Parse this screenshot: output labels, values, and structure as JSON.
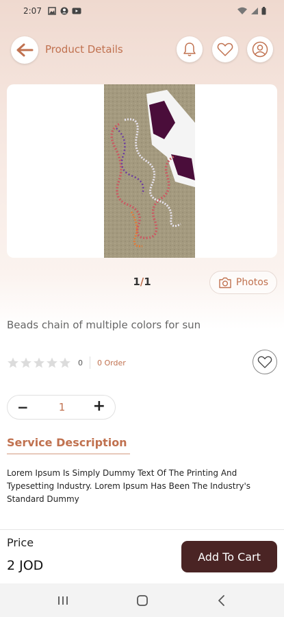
{
  "status_bar": {
    "time": "2:07"
  },
  "header": {
    "title": "Product Details"
  },
  "gallery": {
    "pager_current": "1",
    "pager_separator": "/",
    "pager_total": "1",
    "photos_label": "Photos"
  },
  "product": {
    "name": "Beads chain of multiple colors for sun",
    "rating_count": "0",
    "order_text": "0 Order",
    "quantity": "1"
  },
  "description": {
    "title": "Service Description",
    "text": "Lorem Ipsum Is Simply Dummy Text Of The Printing And Typesetting Industry. Lorem Ipsum Has Been The Industry's Standard Dummy"
  },
  "footer": {
    "price_label": "Price",
    "price_value": "2 JOD",
    "add_to_cart_label": "Add To Cart"
  },
  "colors": {
    "accent": "#c0714f",
    "button_dark": "#4a2424"
  },
  "icons": [
    "back-arrow-icon",
    "bell-icon",
    "heart-icon",
    "user-icon",
    "camera-icon",
    "star-icon"
  ]
}
